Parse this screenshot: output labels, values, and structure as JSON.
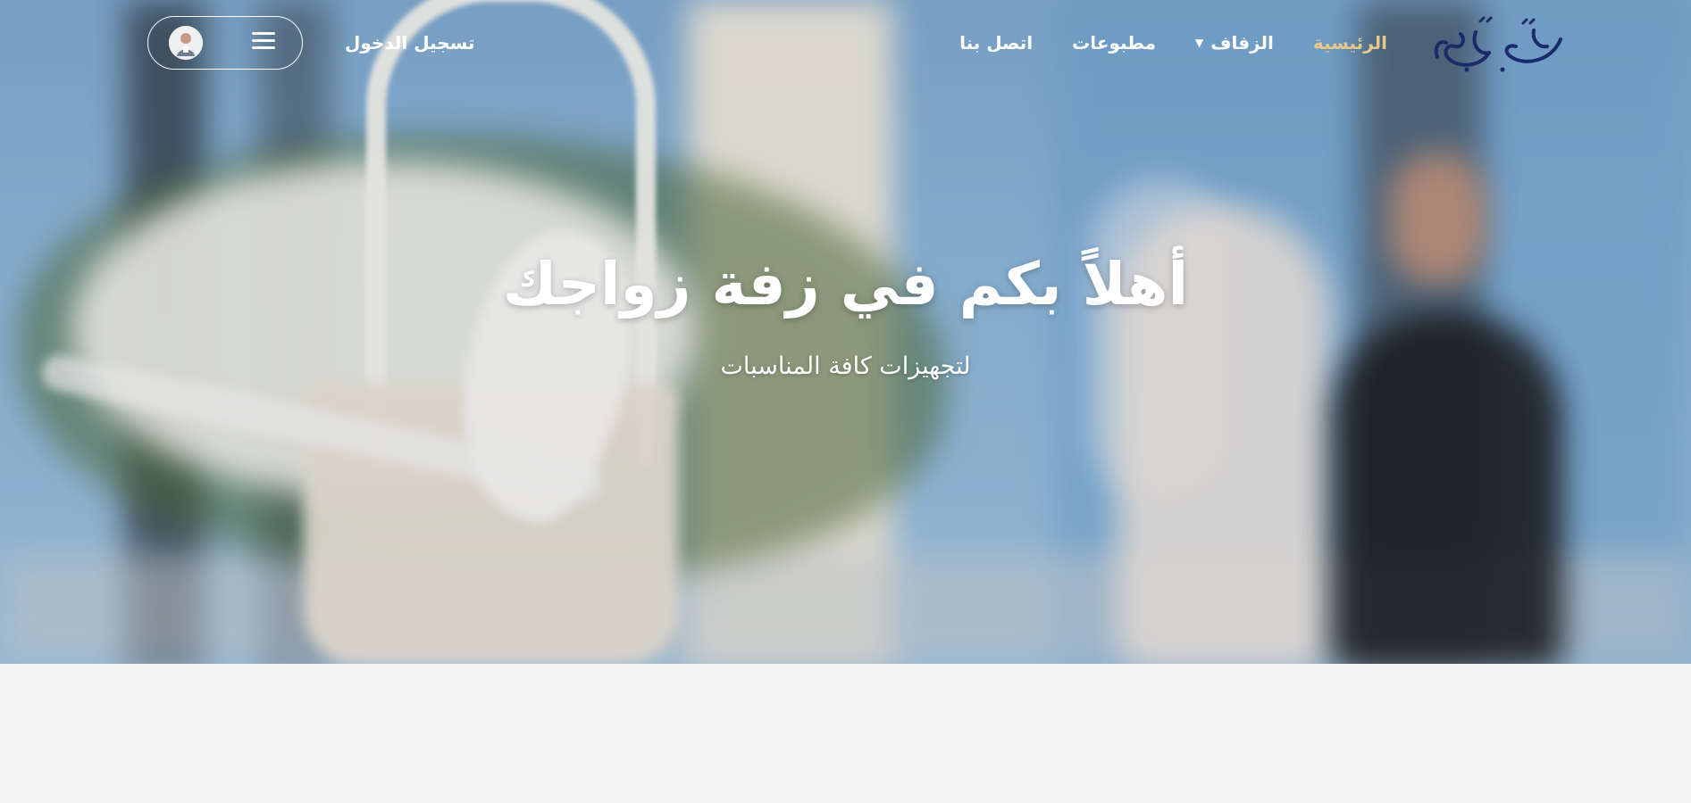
{
  "brand": {
    "logo_text": "زفة زواجك",
    "logo_color": "#1b2a6b"
  },
  "nav": {
    "items": [
      {
        "label": "الرئيسية",
        "active": true
      },
      {
        "label": "الزفاف",
        "has_dropdown": true
      },
      {
        "label": "مطبوعات"
      },
      {
        "label": "اتصل بنا"
      }
    ],
    "login_label": "تسجيل الدخول",
    "accent_color": "#e5c98a"
  },
  "hero": {
    "title": "أهلاً بكم في زفة زواجك",
    "subtitle": "لتجهيزات كافة المناسبات"
  },
  "icons": {
    "menu": "hamburger-icon",
    "caret": "chevron-down-icon",
    "avatar": "user-avatar"
  }
}
